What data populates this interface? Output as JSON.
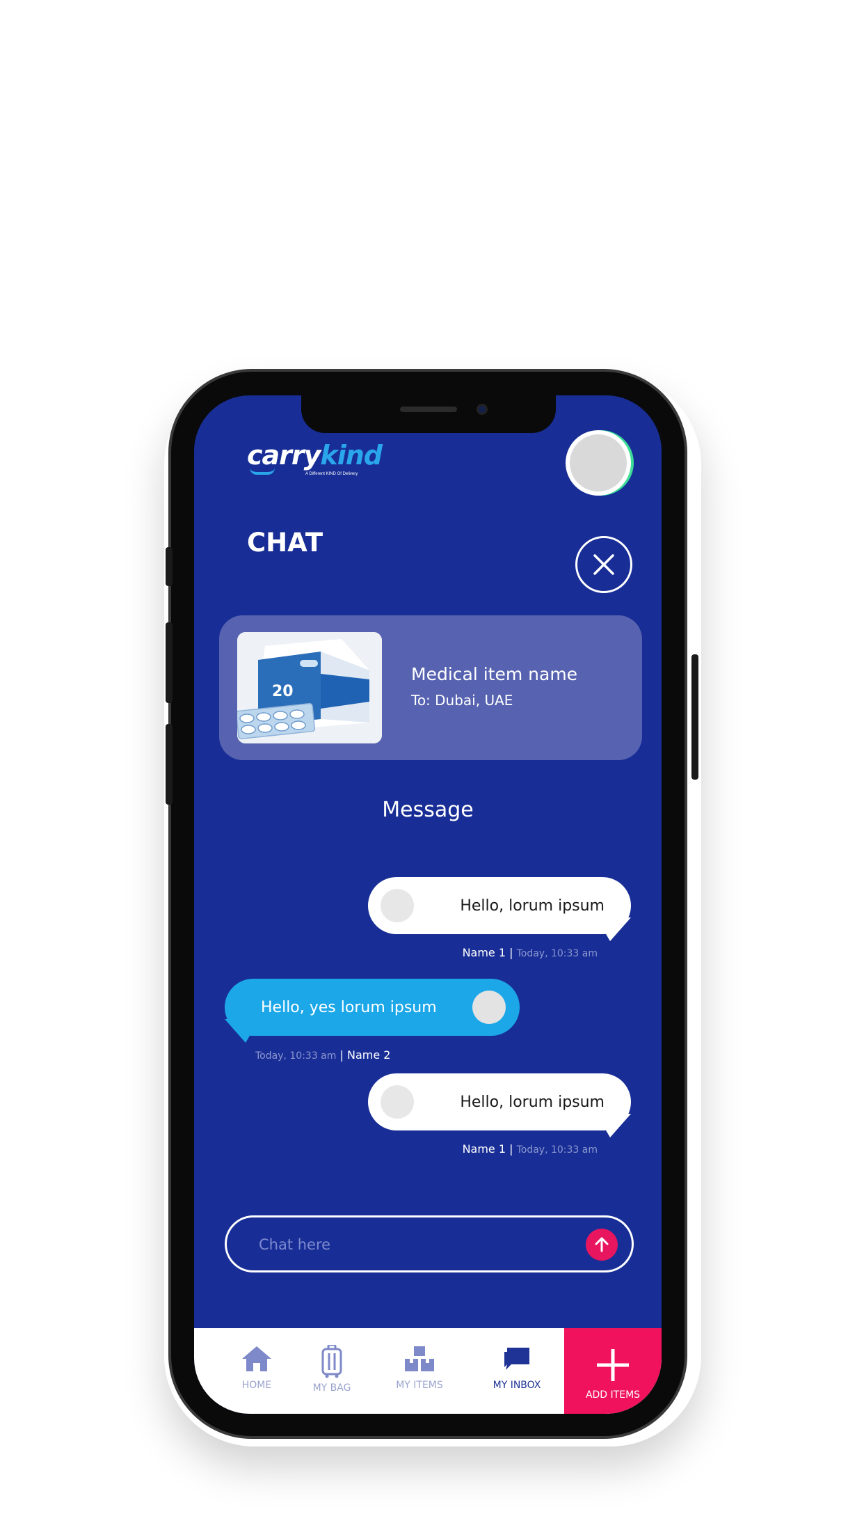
{
  "app": {
    "logo_left": "carry",
    "logo_right": "kind",
    "logo_tagline": "A Different KIND Of Delivery"
  },
  "header": {
    "title": "CHAT"
  },
  "item": {
    "name": "Medical item name",
    "destination": "To: Dubai, UAE",
    "image_label": "20"
  },
  "messages_heading": "Message",
  "messages": [
    {
      "direction": "outgoing",
      "text": "Hello, lorum ipsum",
      "sender": "Name 1",
      "time": "Today, 10:33 am"
    },
    {
      "direction": "incoming",
      "text": "Hello, yes lorum ipsum",
      "sender": "Name 2",
      "time": "Today, 10:33 am"
    },
    {
      "direction": "outgoing",
      "text": "Hello, lorum ipsum",
      "sender": "Name 1",
      "time": "Today, 10:33 am"
    }
  ],
  "composer": {
    "placeholder": "Chat here"
  },
  "bottom_nav": {
    "items": [
      {
        "label": "HOME",
        "icon": "home-icon",
        "active": false
      },
      {
        "label": "MY BAG",
        "icon": "luggage-icon",
        "active": false
      },
      {
        "label": "MY ITEMS",
        "icon": "boxes-icon",
        "active": false
      },
      {
        "label": "MY INBOX",
        "icon": "chat-icon",
        "active": true
      }
    ],
    "cta": {
      "label": "ADD ITEMS",
      "icon": "plus-icon"
    }
  },
  "colors": {
    "background": "#182e96",
    "accent_pink": "#f0125c",
    "accent_blue": "#1ca7e8",
    "card": "#5763b0",
    "online_indicator": "#3ddc97"
  }
}
